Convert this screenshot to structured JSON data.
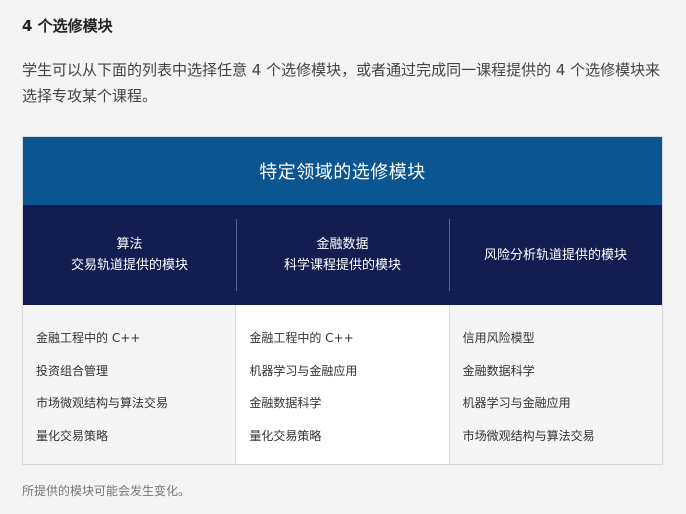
{
  "heading": "4 个选修模块",
  "intro": "学生可以从下面的列表中选择任意 4 个选修模块，或者通过完成同一课程提供的 4 个选修模块来选择专攻某个课程。",
  "table": {
    "title": "特定领域的选修模块",
    "columns": [
      {
        "header_line1": "算法",
        "header_line2": "交易轨道提供的模块",
        "items": [
          "金融工程中的 C++",
          "投资组合管理",
          "市场微观结构与算法交易",
          "量化交易策略"
        ]
      },
      {
        "header_line1": "金融数据",
        "header_line2": "科学课程提供的模块",
        "items": [
          "金融工程中的 C++",
          "机器学习与金融应用",
          "金融数据科学",
          "量化交易策略"
        ]
      },
      {
        "header_line1": "风险分析轨道提供的模块",
        "header_line2": "",
        "items": [
          "信用风险模型",
          "金融数据科学",
          "机器学习与金融应用",
          "市场微观结构与算法交易"
        ]
      }
    ]
  },
  "footnote": "所提供的模块可能会发生变化。",
  "colors": {
    "title_band": "#0b5590",
    "header_band": "#131d52",
    "page_bg": "#f4f4f4"
  }
}
